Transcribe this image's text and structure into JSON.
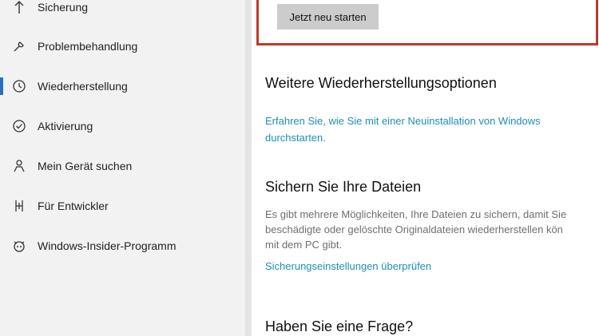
{
  "sidebar": {
    "items": [
      {
        "label": "Sicherung",
        "icon": "arrow-up-icon"
      },
      {
        "label": "Problembehandlung",
        "icon": "wrench-icon"
      },
      {
        "label": "Wiederherstellung",
        "icon": "history-icon",
        "active": true
      },
      {
        "label": "Aktivierung",
        "icon": "check-circle-icon"
      },
      {
        "label": "Mein Gerät suchen",
        "icon": "person-location-icon"
      },
      {
        "label": "Für Entwickler",
        "icon": "developer-icon"
      },
      {
        "label": "Windows-Insider-Programm",
        "icon": "insider-icon"
      }
    ]
  },
  "main": {
    "restart_button": "Jetzt neu starten",
    "more_options": {
      "heading": "Weitere Wiederherstellungsoptionen",
      "link_line1": "Erfahren Sie, wie Sie mit einer Neuinstallation von Windows",
      "link_line2": "durchstarten."
    },
    "backup": {
      "heading": "Sichern Sie Ihre Dateien",
      "text_line1": "Es gibt mehrere Möglichkeiten, Ihre Dateien zu sichern, damit Sie",
      "text_line2": "beschädigte oder gelöschte Originaldateien wiederherstellen kön",
      "text_line3": "mit dem PC gibt.",
      "link": "Sicherungseinstellungen überprüfen"
    },
    "question": {
      "heading": "Haben Sie eine Frage?"
    }
  },
  "colors": {
    "accent": "#2a6ebf",
    "link": "#1d8fb7",
    "highlight_border": "#c0392b"
  }
}
